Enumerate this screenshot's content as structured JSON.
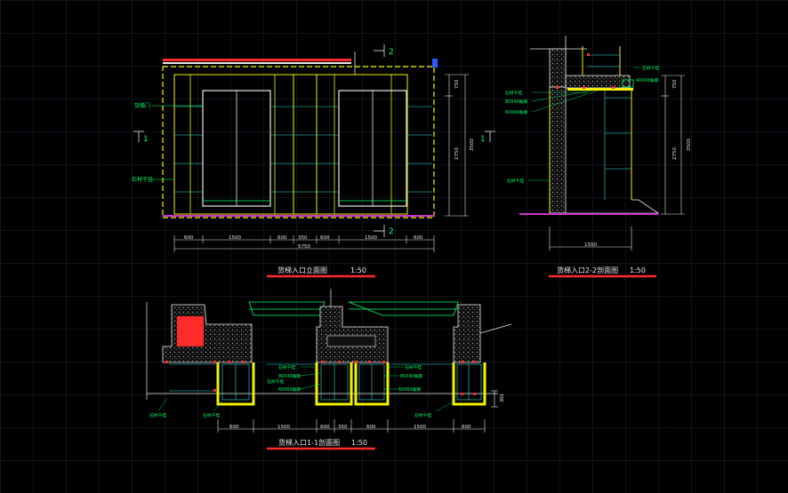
{
  "colors": {
    "background": "#000000",
    "grid": "#1c2a3a",
    "yellow": "#f2f200",
    "white": "#e8e8e8",
    "green": "#00ff66",
    "cyan": "#33dddd",
    "magenta": "#cc33cc",
    "red": "#ff2a2a",
    "gray": "#9a9a9a"
  },
  "elevation": {
    "title": "货梯入口立面图",
    "scale": "1:50",
    "dims_bottom": [
      "600",
      "1500",
      "600",
      "350",
      "600",
      "1500",
      "600"
    ],
    "dim_total": "5750",
    "dims_right": [
      "750",
      "2750",
      "3500"
    ],
    "section_markers": [
      "2",
      "2",
      "1",
      "1"
    ],
    "labels": [
      "货梯门",
      "石材干挂"
    ]
  },
  "section22": {
    "title": "货梯入口2-2剖面图",
    "scale": "1:50",
    "dims_right": [
      "750",
      "2750",
      "3500"
    ],
    "dim_bottom": "1500",
    "labels": [
      "石材干挂",
      "40X40角钢",
      "石材干挂",
      "80X40角钢",
      "60X60角钢",
      "石材干挂"
    ]
  },
  "section11": {
    "title": "货梯入口1-1剖面图",
    "scale": "1:50",
    "dims_bottom": [
      "600",
      "1500",
      "600",
      "350",
      "600",
      "1500",
      "600"
    ],
    "dim_side": "300",
    "labels": [
      "石材干挂",
      "80X40角钢",
      "石材干挂",
      "60X60角钢",
      "石材干挂",
      "80X40角钢",
      "60X60角钢",
      "石材干挂",
      "石材干挂",
      "石材干挂"
    ]
  }
}
